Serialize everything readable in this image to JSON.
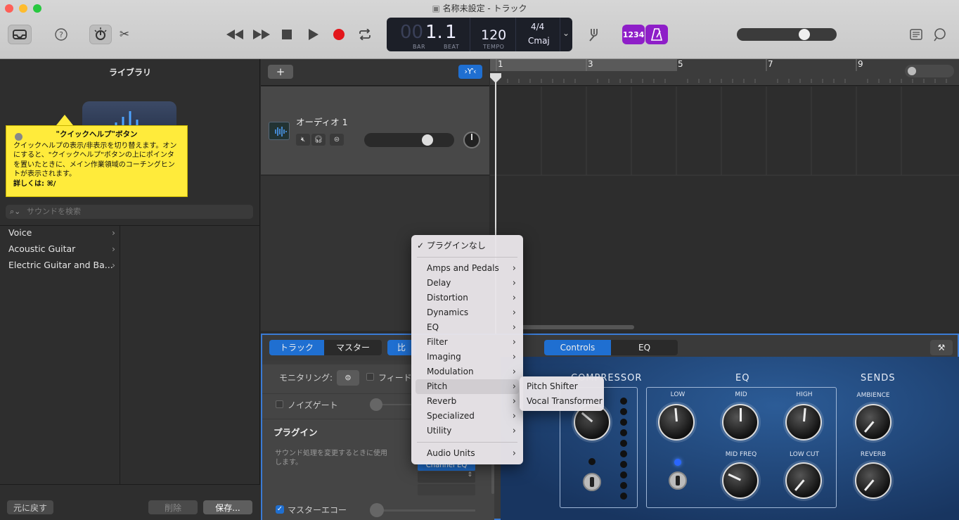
{
  "window": {
    "title": "名称未設定 - トラック"
  },
  "lcd": {
    "bar_dim": "00",
    "bar_value": "1.",
    "beat_value": "1",
    "bar_label": "BAR",
    "beat_label": "BEAT",
    "tempo": "120",
    "tempo_label": "TEMPO",
    "time_sig": "4/4",
    "key": "Cmaj"
  },
  "toolbar": {
    "count_in": "1234",
    "colors": {
      "accent": "#8e1ec8",
      "record": "#e3161b"
    }
  },
  "library": {
    "title": "ライブラリ",
    "help": {
      "title": "\"クイックヘルプ\"ボタン",
      "body": "クイックヘルプの表示/非表示を切り替えます。オンにすると、\"クイックヘルプ\"ボタンの上にポインタを置いたときに、メイン作業領域のコーチングヒントが表示されます。",
      "more": "詳しくは: ⌘/"
    },
    "search_placeholder": "サウンドを検索",
    "items": [
      {
        "label": "Voice"
      },
      {
        "label": "Acoustic Guitar"
      },
      {
        "label": "Electric Guitar and Ba..."
      }
    ],
    "revert_label": "元に戻す",
    "delete_label": "削除",
    "save_label": "保存..."
  },
  "tracks": {
    "add_label": "+",
    "track_name": "オーディオ 1",
    "ruler_marks": [
      "1",
      "3",
      "5",
      "7",
      "9"
    ]
  },
  "editor": {
    "tab_track": "トラック",
    "tab_master": "マスター",
    "tab_compare": "比",
    "controls_label": "Controls",
    "eq_label": "EQ",
    "monitoring_label": "モニタリング:",
    "feedback_label": "フィード",
    "noise_gate_label": "ノイズゲート",
    "plugin_heading": "プラグイン",
    "plugin_desc": "サウンド処理を変更するときに使用します。",
    "channel_eq_label": "Channel EQ",
    "master_echo_label": "マスターエコー",
    "panel": {
      "compressor": "COMPRESSOR",
      "eq": "EQ",
      "sends": "SENDS",
      "low": "LOW",
      "mid": "MID",
      "high": "HIGH",
      "mid_freq": "MID FREQ",
      "low_cut": "LOW CUT",
      "ambience": "AMBIENCE",
      "reverb": "REVERB"
    }
  },
  "menu": {
    "no_plugin": "✓ プラグインなし",
    "items": [
      {
        "label": "Amps and Pedals"
      },
      {
        "label": "Delay"
      },
      {
        "label": "Distortion"
      },
      {
        "label": "Dynamics"
      },
      {
        "label": "EQ"
      },
      {
        "label": "Filter"
      },
      {
        "label": "Imaging"
      },
      {
        "label": "Modulation"
      },
      {
        "label": "Pitch"
      },
      {
        "label": "Reverb"
      },
      {
        "label": "Specialized"
      },
      {
        "label": "Utility"
      }
    ],
    "audio_units": "Audio Units",
    "submenu": [
      {
        "label": "Pitch Shifter"
      },
      {
        "label": "Vocal Transformer"
      }
    ]
  }
}
